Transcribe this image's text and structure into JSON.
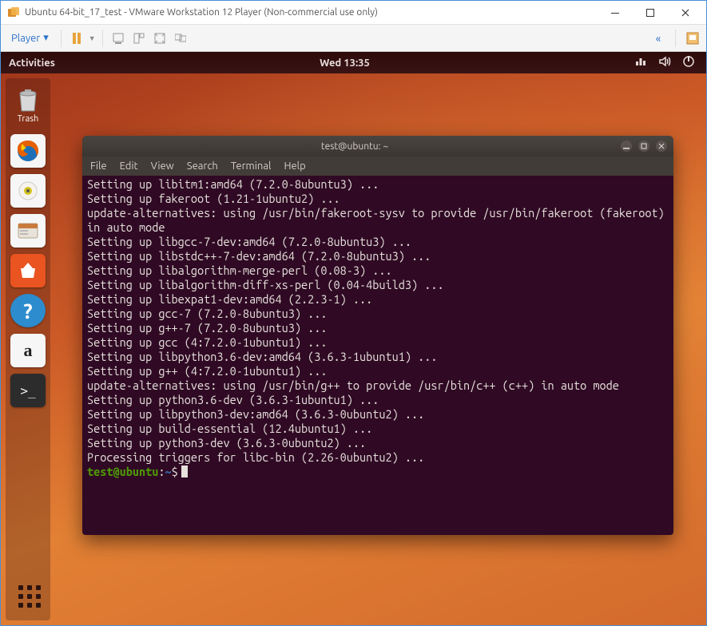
{
  "window": {
    "title": "Ubuntu 64-bit_17_test - VMware Workstation 12 Player (Non-commercial use only)"
  },
  "vmtoolbar": {
    "player_label": "Player"
  },
  "topbar": {
    "activities": "Activities",
    "clock": "Wed 13:35"
  },
  "launcher": {
    "trash_label": "Trash"
  },
  "terminal": {
    "title": "test@ubuntu: ~",
    "menu": {
      "file": "File",
      "edit": "Edit",
      "view": "View",
      "search": "Search",
      "terminal": "Terminal",
      "help": "Help"
    },
    "lines": [
      "Setting up libitm1:amd64 (7.2.0-8ubuntu3) ...",
      "Setting up fakeroot (1.21-1ubuntu2) ...",
      "update-alternatives: using /usr/bin/fakeroot-sysv to provide /usr/bin/fakeroot (fakeroot) in auto mode",
      "Setting up libgcc-7-dev:amd64 (7.2.0-8ubuntu3) ...",
      "Setting up libstdc++-7-dev:amd64 (7.2.0-8ubuntu3) ...",
      "Setting up libalgorithm-merge-perl (0.08-3) ...",
      "Setting up libalgorithm-diff-xs-perl (0.04-4build3) ...",
      "Setting up libexpat1-dev:amd64 (2.2.3-1) ...",
      "Setting up gcc-7 (7.2.0-8ubuntu3) ...",
      "Setting up g++-7 (7.2.0-8ubuntu3) ...",
      "Setting up gcc (4:7.2.0-1ubuntu1) ...",
      "Setting up libpython3.6-dev:amd64 (3.6.3-1ubuntu1) ...",
      "Setting up g++ (4:7.2.0-1ubuntu1) ...",
      "update-alternatives: using /usr/bin/g++ to provide /usr/bin/c++ (c++) in auto mode",
      "Setting up python3.6-dev (3.6.3-1ubuntu1) ...",
      "Setting up libpython3-dev:amd64 (3.6.3-0ubuntu2) ...",
      "Setting up build-essential (12.4ubuntu1) ...",
      "Setting up python3-dev (3.6.3-0ubuntu2) ...",
      "Processing triggers for libc-bin (2.26-0ubuntu2) ..."
    ],
    "prompt": {
      "user": "test@ubuntu",
      "sep": ":",
      "path": "~",
      "end": "$"
    }
  },
  "icons": {
    "minimize": "minimize-icon",
    "maximize": "maximize-icon",
    "close": "close-icon"
  }
}
